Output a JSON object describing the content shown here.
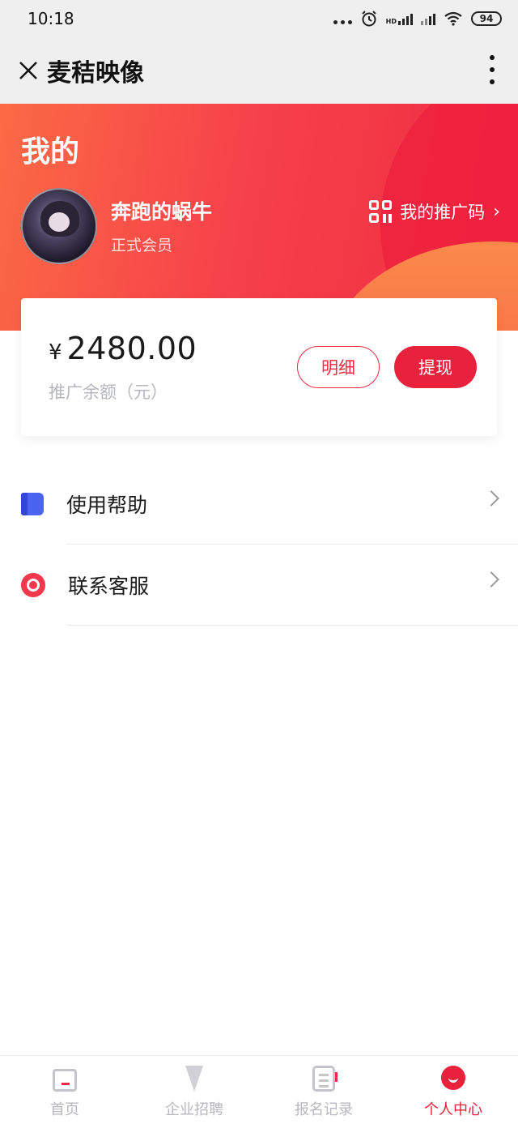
{
  "status_bar": {
    "time": "10:18",
    "network": "HD",
    "battery": "94"
  },
  "nav": {
    "title": "麦秸映像"
  },
  "header": {
    "page_title": "我的",
    "username": "奔跑的蜗牛",
    "member_level": "正式会员",
    "promo_code_label": "我的推广码"
  },
  "balance": {
    "currency": "¥",
    "amount": "2480.00",
    "label": "推广余额（元）",
    "detail_button": "明细",
    "withdraw_button": "提现"
  },
  "menu": [
    {
      "label": "使用帮助",
      "icon": "book-icon"
    },
    {
      "label": "联系客服",
      "icon": "customer-service-icon"
    }
  ],
  "tabbar": {
    "tabs": [
      {
        "label": "首页",
        "icon": "home-icon"
      },
      {
        "label": "企业招聘",
        "icon": "tie-icon"
      },
      {
        "label": "报名记录",
        "icon": "record-icon"
      },
      {
        "label": "个人中心",
        "icon": "user-icon",
        "active": true
      }
    ]
  },
  "colors": {
    "brand_red": "#e8213c",
    "header_gradient_start": "#fb6a45",
    "header_gradient_end": "#ef2a42",
    "help_icon": "#4a63f0",
    "tab_inactive": "#b7b7bd"
  }
}
